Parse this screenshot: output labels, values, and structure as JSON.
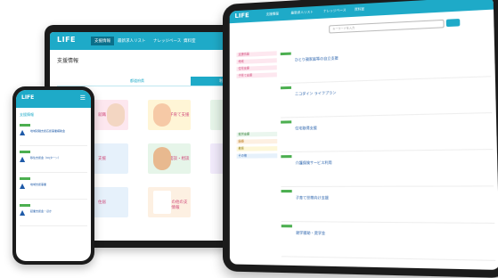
{
  "laptop": {
    "logo": "LIFE",
    "nav_items": [
      "支援情報",
      "最新求人リスト",
      "ナレッジベース",
      "資料室"
    ],
    "nav_right": "ヘルプ",
    "page_title": "支援情報",
    "tabs": [
      "都道府県",
      "利用目的"
    ],
    "cards": [
      "就職",
      "子育て支援",
      "就職",
      "支援",
      "面談・相談",
      "住宅",
      "住居",
      "その他の支援情報"
    ]
  },
  "phone": {
    "logo": "LIFE",
    "menu_icon": "hamburger-icon",
    "header_text": "支援情報",
    "items": [
      "地域就職支援応援事業補助金",
      "移住支援金（UIJターン）",
      "地域支援事業",
      "起業支援金・ほか"
    ]
  },
  "tablet": {
    "logo": "LIFE",
    "nav_items": [
      "支援情報",
      "最新求人リスト",
      "ナレッジベース",
      "資料室"
    ],
    "search_placeholder": "キーワードを入力",
    "sidebar_items": [
      "支援情報",
      "地域",
      "住宅支援",
      "子育て支援",
      "就労支援",
      "医療",
      "教育",
      "その他"
    ],
    "list_items": [
      "ひとり親家庭等の自立支援",
      "ニコダイン ライフプラン",
      "住宅取得支援",
      "介護保険サービス利用",
      "子育て世帯向け支援",
      "就学援助・奨学金"
    ],
    "colors": {
      "accent": "#1eaac8",
      "badge": "#4caf50"
    }
  }
}
